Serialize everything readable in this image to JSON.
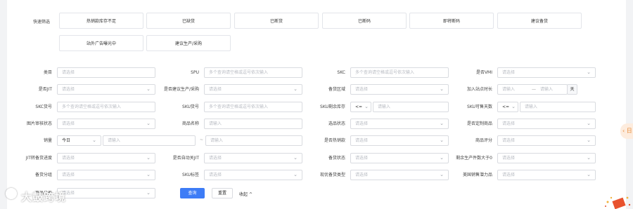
{
  "quick_filter": {
    "label": "快速筛选",
    "buttons": [
      "热销款库存不足",
      "已缺货",
      "已断货",
      "已断码",
      "即将断码",
      "建议备货",
      "站外广告曝光中",
      "建议生产/采购"
    ]
  },
  "filters": {
    "row1": [
      {
        "label": "类目",
        "placeholder": "请选择"
      },
      {
        "label": "SPU",
        "placeholder": "多个查询请空格或逗号依次输入"
      },
      {
        "label": "SKC",
        "placeholder": "多个查询请空格或逗号依次输入"
      },
      {
        "label": "是否VMI",
        "placeholder": "请选择"
      }
    ],
    "row2": [
      {
        "label": "是否JIT",
        "placeholder": "请选择"
      },
      {
        "label": "是否建议生产/采购",
        "placeholder": "请选择"
      },
      {
        "label": "备货区域",
        "placeholder": "请选择"
      },
      {
        "label": "加入站点时长",
        "placeholder_from": "请输入",
        "separator": "—",
        "placeholder_to": "请输入",
        "unit": "天"
      }
    ],
    "row3": [
      {
        "label": "SKC货号",
        "placeholder": "多个查询请空格或逗号依次输入"
      },
      {
        "label": "SKU货号",
        "placeholder": "多个查询请空格或逗号依次输入"
      },
      {
        "label": "SKU剩余库存",
        "operator": "<=",
        "placeholder": "请输入"
      },
      {
        "label": "SKU可售天数",
        "operator": "<=",
        "placeholder": "请输入"
      }
    ],
    "row4": [
      {
        "label": "图片审核状态",
        "placeholder": "请选择"
      },
      {
        "label": "商品名称",
        "placeholder": "请输入"
      },
      {
        "label": "选品状态",
        "placeholder": "请选择"
      },
      {
        "label": "是否定制商品",
        "placeholder": "请选择"
      }
    ],
    "row5": [
      {
        "label": "销量",
        "period": "今日",
        "placeholder_from": "请输入",
        "separator": "~",
        "placeholder_to": "请输入"
      },
      {
        "label": "是否热销款",
        "placeholder": "请选择"
      },
      {
        "label": "商品评分",
        "placeholder": "请选择"
      }
    ],
    "row6": [
      {
        "label": "JIT转备货进度",
        "placeholder": "请选择"
      },
      {
        "label": "是否自动关JIT",
        "placeholder": "请选择"
      },
      {
        "label": "备货状态",
        "placeholder": "请选择"
      },
      {
        "label": "剩余生产件数大于0",
        "placeholder": "请选择"
      }
    ],
    "row7": [
      {
        "label": "备货分组",
        "placeholder": "请选择"
      },
      {
        "label": "SKU标签",
        "placeholder": "请选择"
      },
      {
        "label": "现优备货类型",
        "placeholder": "请选择"
      },
      {
        "label": "美国销售潜力品",
        "placeholder": "请选择"
      }
    ],
    "row8": [
      {
        "label": "商品分类",
        "placeholder": "请选择"
      }
    ]
  },
  "actions": {
    "search": "查询",
    "reset": "重置",
    "collapse": "收起"
  },
  "side_tab": "‹ 日",
  "watermark": "大鼓跨境"
}
